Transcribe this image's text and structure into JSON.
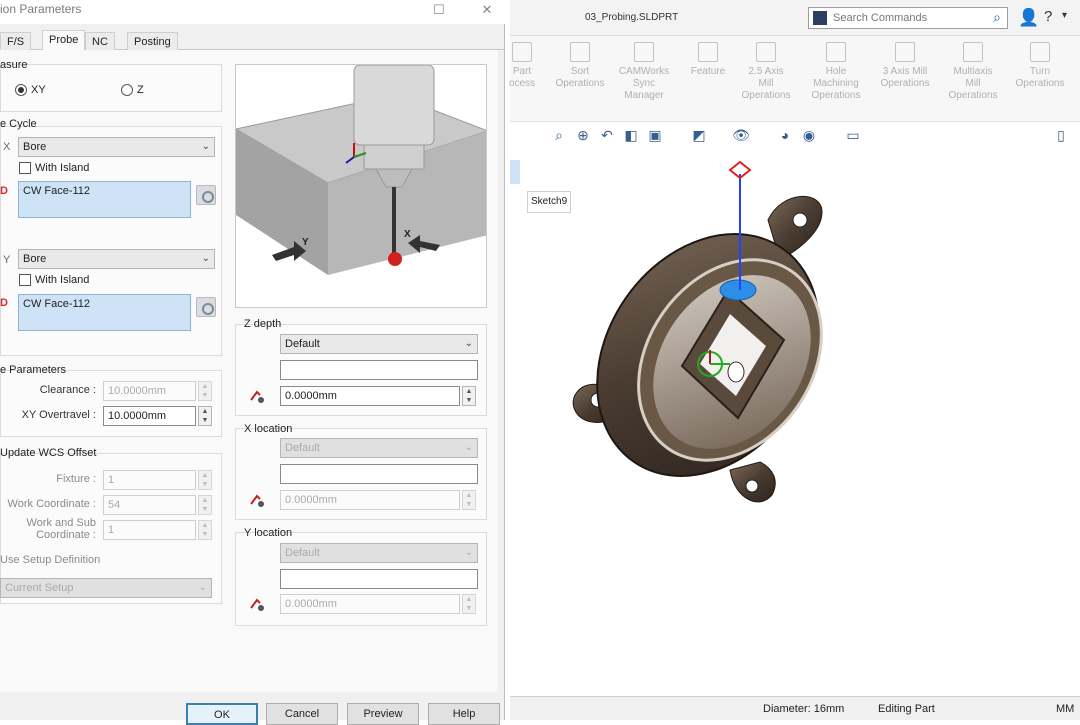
{
  "dialog": {
    "title": "ion Parameters",
    "tabs": [
      "F/S",
      "Probe",
      "NC",
      "Posting"
    ],
    "active_tab": "Probe",
    "measure": {
      "label": "asure",
      "options": [
        "XY",
        "Z"
      ],
      "selected": "XY"
    },
    "probe_cycle": {
      "label": "e Cycle",
      "x_axis_label": "X",
      "x_cycle": "Bore",
      "x_with_island": "With Island",
      "x_feature": "CW Face-112",
      "y_axis_label": "Y",
      "y_cycle": "Bore",
      "y_with_island": "With Island",
      "y_feature": "CW Face-112",
      "id_marker": "D"
    },
    "probe_parameters": {
      "label": "e Parameters",
      "clearance_label": "Clearance :",
      "clearance_value": "10.0000mm",
      "xy_overtravel_label": "XY Overtravel :",
      "xy_overtravel_value": "10.0000mm"
    },
    "wcs_offset": {
      "label": "Update WCS Offset",
      "fixture_label": "Fixture :",
      "fixture_value": "1",
      "work_coord_label": "Work Coordinate :",
      "work_coord_value": "54",
      "work_sub_label_1": "Work and Sub",
      "work_sub_label_2": "Coordinate :",
      "work_sub_value": "1",
      "use_setup_label": "Use Setup Definition",
      "setup_value": "Current Setup"
    },
    "z_depth": {
      "label": "Z depth",
      "mode": "Default",
      "expr": "",
      "value": "0.0000mm"
    },
    "x_location": {
      "label": "X location",
      "mode": "Default",
      "expr": "",
      "value": "0.0000mm"
    },
    "y_location": {
      "label": "Y location",
      "mode": "Default",
      "expr": "",
      "value": "0.0000mm"
    },
    "preview_axes": {
      "x": "X",
      "y": "Y"
    },
    "buttons": {
      "ok": "OK",
      "cancel": "Cancel",
      "preview": "Preview",
      "help": "Help"
    }
  },
  "cad": {
    "document_title": "03_Probing.SLDPRT",
    "search_placeholder": "Search Commands",
    "ribbon": [
      {
        "label": "Part\nocess",
        "icon": "process-icon"
      },
      {
        "label": "Sort\nOperations",
        "icon": "sort-icon"
      },
      {
        "label": "CAMWorks\nSync\nManager",
        "icon": "sync-icon"
      },
      {
        "label": "Feature",
        "icon": "feature-icon"
      },
      {
        "label": "2.5 Axis\nMill\nOperations",
        "icon": "mill-25-icon"
      },
      {
        "label": "Hole\nMachining\nOperations",
        "icon": "hole-icon"
      },
      {
        "label": "3 Axis Mill\nOperations",
        "icon": "mill-3-icon"
      },
      {
        "label": "Multiaxis\nMill\nOperations",
        "icon": "multiaxis-icon"
      },
      {
        "label": "Turn\nOperations",
        "icon": "turn-icon"
      }
    ],
    "sketch_tag": "Sketch9",
    "status": {
      "diameter": "Diameter: 16mm",
      "mode": "Editing Part",
      "units": "MM"
    },
    "colors": {
      "accent": "#1f5fa8",
      "part": "#5a4a3c",
      "axis": "#2244ff"
    }
  }
}
